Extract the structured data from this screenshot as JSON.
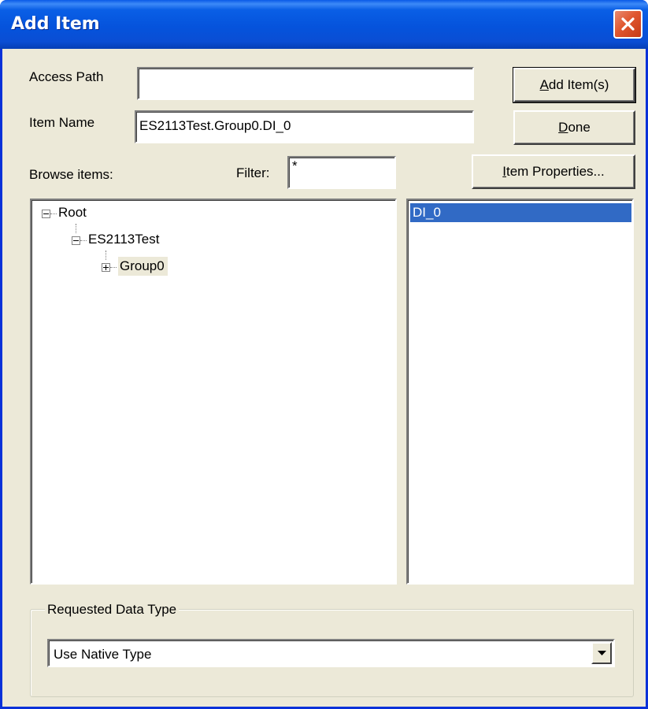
{
  "window": {
    "title": "Add Item"
  },
  "form": {
    "access_path_label": "Access Path",
    "access_path_value": "",
    "item_name_label": "Item Name",
    "item_name_value": "ES2113Test.Group0.DI_0",
    "browse_label": "Browse items:",
    "filter_label": "Filter:",
    "filter_value": "*"
  },
  "buttons": {
    "add_items": "Add Item(s)",
    "done": "Done",
    "item_properties": "Item Properties..."
  },
  "tree": {
    "nodes": [
      {
        "label": "Root",
        "expander": "minus"
      },
      {
        "label": "ES2113Test",
        "expander": "minus"
      },
      {
        "label": "Group0",
        "expander": "plus",
        "selected": true
      }
    ]
  },
  "item_list": {
    "items": [
      {
        "label": "DI_0",
        "selected": true
      }
    ]
  },
  "data_type": {
    "group_label": "Requested Data Type",
    "selected": "Use Native Type"
  },
  "colors": {
    "selection": "#316ac5",
    "dialog_bg": "#ece9d8",
    "title_bar": "#0553dc"
  }
}
